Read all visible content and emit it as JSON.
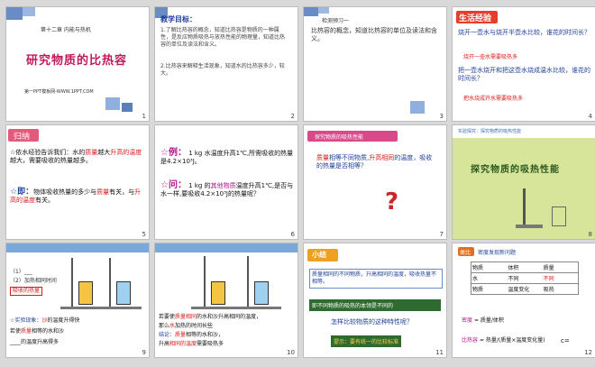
{
  "slides": [
    {
      "num": "1",
      "chapter": "第十二章 内能与热机",
      "title": "研究物质的比热容",
      "footer": "第一PPT模板网-WWW.1PPT.COM"
    },
    {
      "num": "2",
      "heading": "教学目标：",
      "p1": "1.了解比热容的概念，知道比热容是物质的一种属性，是反应物质吸热与放热性能的物理量，知道比热容的单位及读法和含义。",
      "p2": "2.比热容来解释生活现象，知道水的比热容多少，较大。"
    },
    {
      "num": "3",
      "heading": "检测预习一",
      "p1": "比热容的概念，知道比热容的单位及读法和含义。"
    },
    {
      "num": "4",
      "heading": "生活经验",
      "q1": "烧开一壶水与烧开半壶水比较，谁花的时间长？",
      "a1": "烧开一壶水需要吸热多",
      "q2": "把一壶水烧开和把这壶水烧成温水比较，谁花的时间长？",
      "a2": "把水烧成开水需要吸热多"
    },
    {
      "num": "5",
      "heading": "归纳",
      "p1a": "☆依水经验告诉我们：水的",
      "p1b": "质量",
      "p1c": "越大",
      "p1d": "升高的温度",
      "p1e": "越大，需要吸收的热量越多。",
      "p2a": "☆即：",
      "p2b": "物体吸收热量的多少与",
      "p2c": "质量",
      "p2d": "有关，与",
      "p2e": "升高的温度",
      "p2f": "有关。"
    },
    {
      "num": "6",
      "ex": "☆例：",
      "exText": "1 kg 水温度升高1℃,所需吸收的热量是4.2×10³J。",
      "q": "☆问：",
      "qText": "1 kg 的",
      "qMag": "其他物质",
      "qText2": "温度升高1℃,是否与水一样,要吸收4.2×10³J的热量呢？"
    },
    {
      "num": "7",
      "heading": "探究物质的吸热性能",
      "p1a": "质量",
      "p1b": "相等不同物质,",
      "p1c": "升高相同",
      "p1d": "的温度，吸收的热量是否相等？",
      "qmark": "?"
    },
    {
      "num": "8",
      "heading": "实验探究：探究物质的吸热性能",
      "title": "探究物质的吸热性能"
    },
    {
      "num": "9",
      "p1": "（1）___",
      "p2": "（2）加热相同时间",
      "p3": "吸收的热量",
      "p4a": "☆实验现象：",
      "p4b": "沙",
      "p4c": "的温度升得快",
      "p5a": "若使",
      "p5b": "质量",
      "p5c": "相等的水和沙",
      "p6": "____的温度升高得多"
    },
    {
      "num": "10",
      "p1a": "若要使",
      "p1b": "质量相同",
      "p1c": "的水和沙升高相同的温度，",
      "p2": "那么",
      "p2b": "水",
      "p2c": "加热的时间长些",
      "p3a": "结论：",
      "p3b": "质量",
      "p3c": "相等的水和沙，",
      "p4a": "升高",
      "p4b": "相同的温度",
      "p4c": "需要吸热多"
    },
    {
      "num": "11",
      "heading": "小结",
      "p1": "质量相同的不同物质，升高相同的温度，吸收热量不相等。",
      "p2": "即不同物质的吸热的本领是不同的",
      "p3": "怎样比较物质的这种特性呢？",
      "p4": "提示：要有统一的比较标准"
    },
    {
      "num": "12",
      "heading": "类比",
      "sub": "密度发现新问题",
      "col1": "物质",
      "col2": "体积",
      "col3": "质量",
      "row1": [
        "水",
        "不同",
        "不同"
      ],
      "row2": [
        "物质",
        "温度变化",
        "吸热"
      ],
      "f1a": "密度",
      "f1b": "= 质量/体积",
      "f2a": "比热容",
      "f2b": "= 热量/(质量×温度变化量)",
      "f3": "c="
    }
  ]
}
